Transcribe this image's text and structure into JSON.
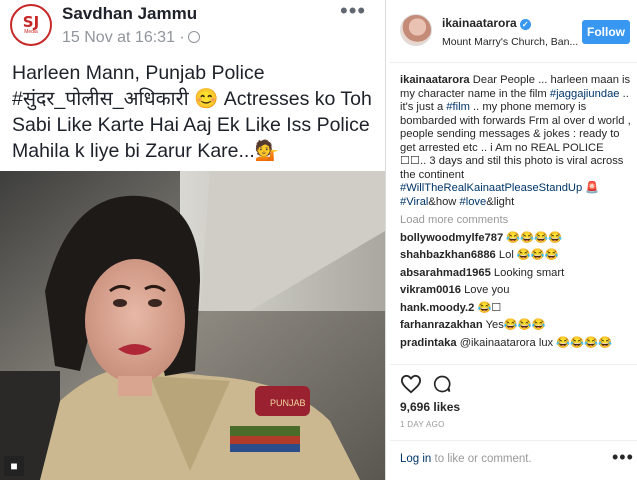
{
  "facebook_post": {
    "logo_text": "SJ",
    "logo_subtext": "Media",
    "page_name": "Savdhan Jammu",
    "timestamp": "15 Nov at 16:31 ·",
    "more_icon": "•••",
    "post_text": "Harleen Mann, Punjab Police #सुंदर_पोलीस_अधिकारी 😊 Actresses ko Toh Sabi Like Karte Hai Aaj Ek Like Iss Police Mahila k liye bi Zarur Kare...💁",
    "photo_badge_text": "PUNJAB"
  },
  "instagram": {
    "username": "ikainaatarora",
    "verified_icon": "✓",
    "location": "Mount Marry's Church, Ban...",
    "follow_label": "Follow",
    "caption_user": "ikainaatarora",
    "caption_parts": {
      "p1": " Dear People ... harleen maan is my character name in the film ",
      "tag1": "#jaggajiundae",
      "p2": " .. it's just a ",
      "tag2": "#film",
      "p3": " .. my phone memory is bombarded with forwards Frm al over d world , people sending messages & jokes : ready to get arrested etc .. i Am no REAL POLICE ☐☐.. 3 days and stil this photo is viral across the continent ",
      "tag3": "#WillTheRealKainaatPleaseStandUp",
      "p4": " 🚨 ",
      "tag4": "#Viral",
      "p5": "&how ",
      "tag5": "#love",
      "p6": "&light"
    },
    "load_more": "Load more comments",
    "comments": [
      {
        "user": "bollywoodmylfe787",
        "text": "😂😂😂😂"
      },
      {
        "user": "shahbazkhan6886",
        "text": "Lol 😂😂😂"
      },
      {
        "user": "absarahmad1965",
        "text": "Looking smart"
      },
      {
        "user": "vikram0016",
        "text": "Love you"
      },
      {
        "user": "hank.moody.2",
        "text": "😂☐"
      },
      {
        "user": "farhanrazakhan",
        "text": "Yes😂😂😂"
      },
      {
        "user": "pradintaka",
        "text": "@ikainaatarora lux 😂😂😂😂"
      }
    ],
    "likes": "9,696 likes",
    "time_ago": "1 DAY AGO",
    "login_link": "Log in",
    "login_rest": " to like or comment.",
    "more_icon": "•••"
  }
}
